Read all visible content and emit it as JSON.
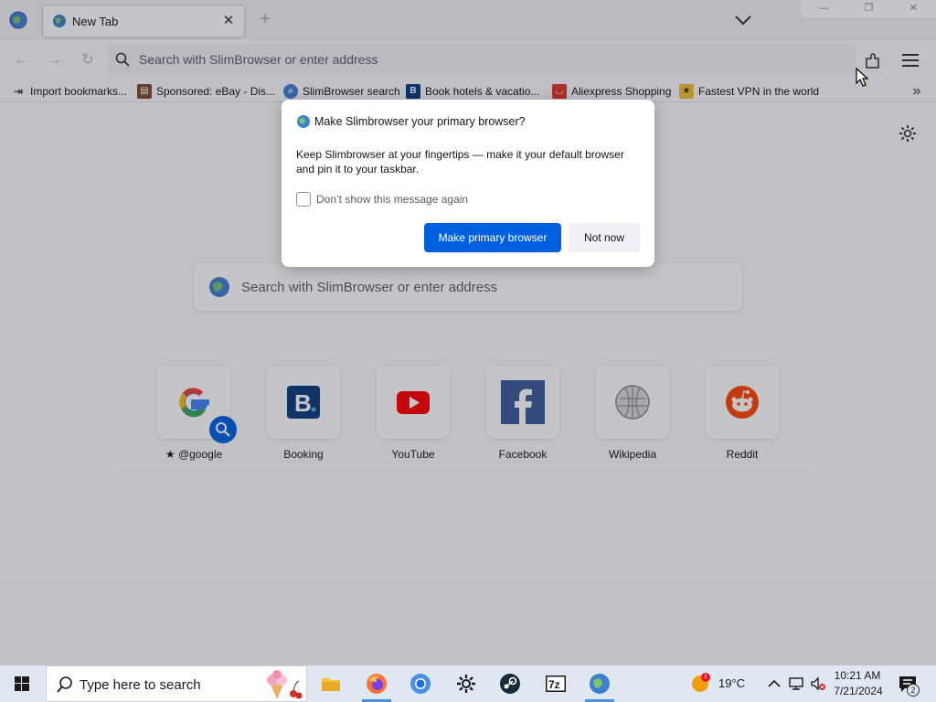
{
  "tab": {
    "title": "New Tab"
  },
  "urlbar": {
    "placeholder": "Search with SlimBrowser or enter address"
  },
  "bookmarks": [
    {
      "label": "Import bookmarks...",
      "icon": "import-icon"
    },
    {
      "label": "Sponsored: eBay - Dis...",
      "icon": "ebay-icon"
    },
    {
      "label": "SlimBrowser search",
      "icon": "search-icon"
    },
    {
      "label": "Book hotels & vacatio...",
      "icon": "booking-icon"
    },
    {
      "label": "Aliexpress Shopping",
      "icon": "aliexpress-icon"
    },
    {
      "label": "Fastest VPN in the world",
      "icon": "vpn-icon"
    }
  ],
  "newtab": {
    "search_placeholder": "Search with SlimBrowser or enter address",
    "top_sites": [
      {
        "label": "@google",
        "icon": "google-icon",
        "pinned": true
      },
      {
        "label": "Booking",
        "icon": "booking-icon"
      },
      {
        "label": "YouTube",
        "icon": "youtube-icon"
      },
      {
        "label": "Facebook",
        "icon": "facebook-icon"
      },
      {
        "label": "Wikipedia",
        "icon": "wikipedia-icon"
      },
      {
        "label": "Reddit",
        "icon": "reddit-icon"
      }
    ]
  },
  "dialog": {
    "title": "Make Slimbrowser your primary browser?",
    "body": "Keep Slimbrowser at your fingertips — make it your default browser and pin it to your taskbar.",
    "checkbox_label": "Don’t show this message again",
    "checkbox_checked": false,
    "primary_label": "Make primary browser",
    "secondary_label": "Not now"
  },
  "taskbar": {
    "search_placeholder": "Type here to search",
    "apps": [
      "file-explorer-icon",
      "firefox-icon",
      "chromium-icon",
      "settings-icon",
      "steam-icon",
      "7zip-icon",
      "slimbrowser-icon"
    ],
    "weather": {
      "temp": "19°C",
      "badge": "1"
    },
    "clock": {
      "time": "10:21 AM",
      "date": "7/21/2024"
    },
    "notifications": "2"
  },
  "colors": {
    "accent": "#0061e0",
    "tab_bg": "#f0f0f4",
    "taskbar_bg": "#dfe7f1"
  }
}
